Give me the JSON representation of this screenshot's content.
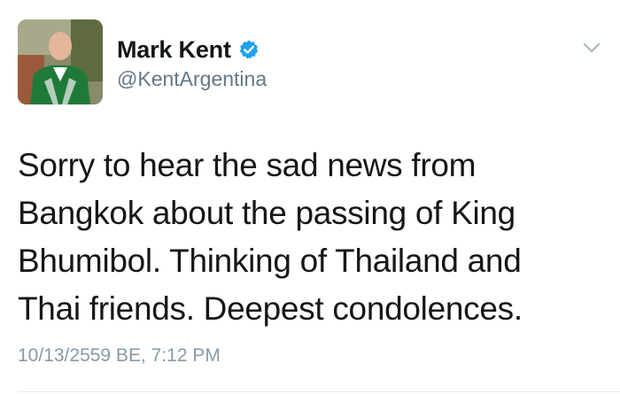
{
  "user": {
    "display_name": "Mark Kent",
    "handle": "@KentArgentina",
    "verified": true,
    "avatar": "avatar-photo"
  },
  "tweet": {
    "text_lines": [
      "Sorry to hear the sad news from",
      "Bangkok about the passing of King",
      "Bhumibol. Thinking of Thailand and",
      "Thai friends. Deepest condolences."
    ],
    "timestamp": "10/13/2559 BE, 7:12 PM"
  },
  "icons": {
    "verified": "verified-badge-icon",
    "more": "chevron-down-icon"
  },
  "colors": {
    "verified_blue": "#1da1f2",
    "text": "#14171a",
    "secondary": "#657786",
    "timestamp": "#8899a6"
  }
}
